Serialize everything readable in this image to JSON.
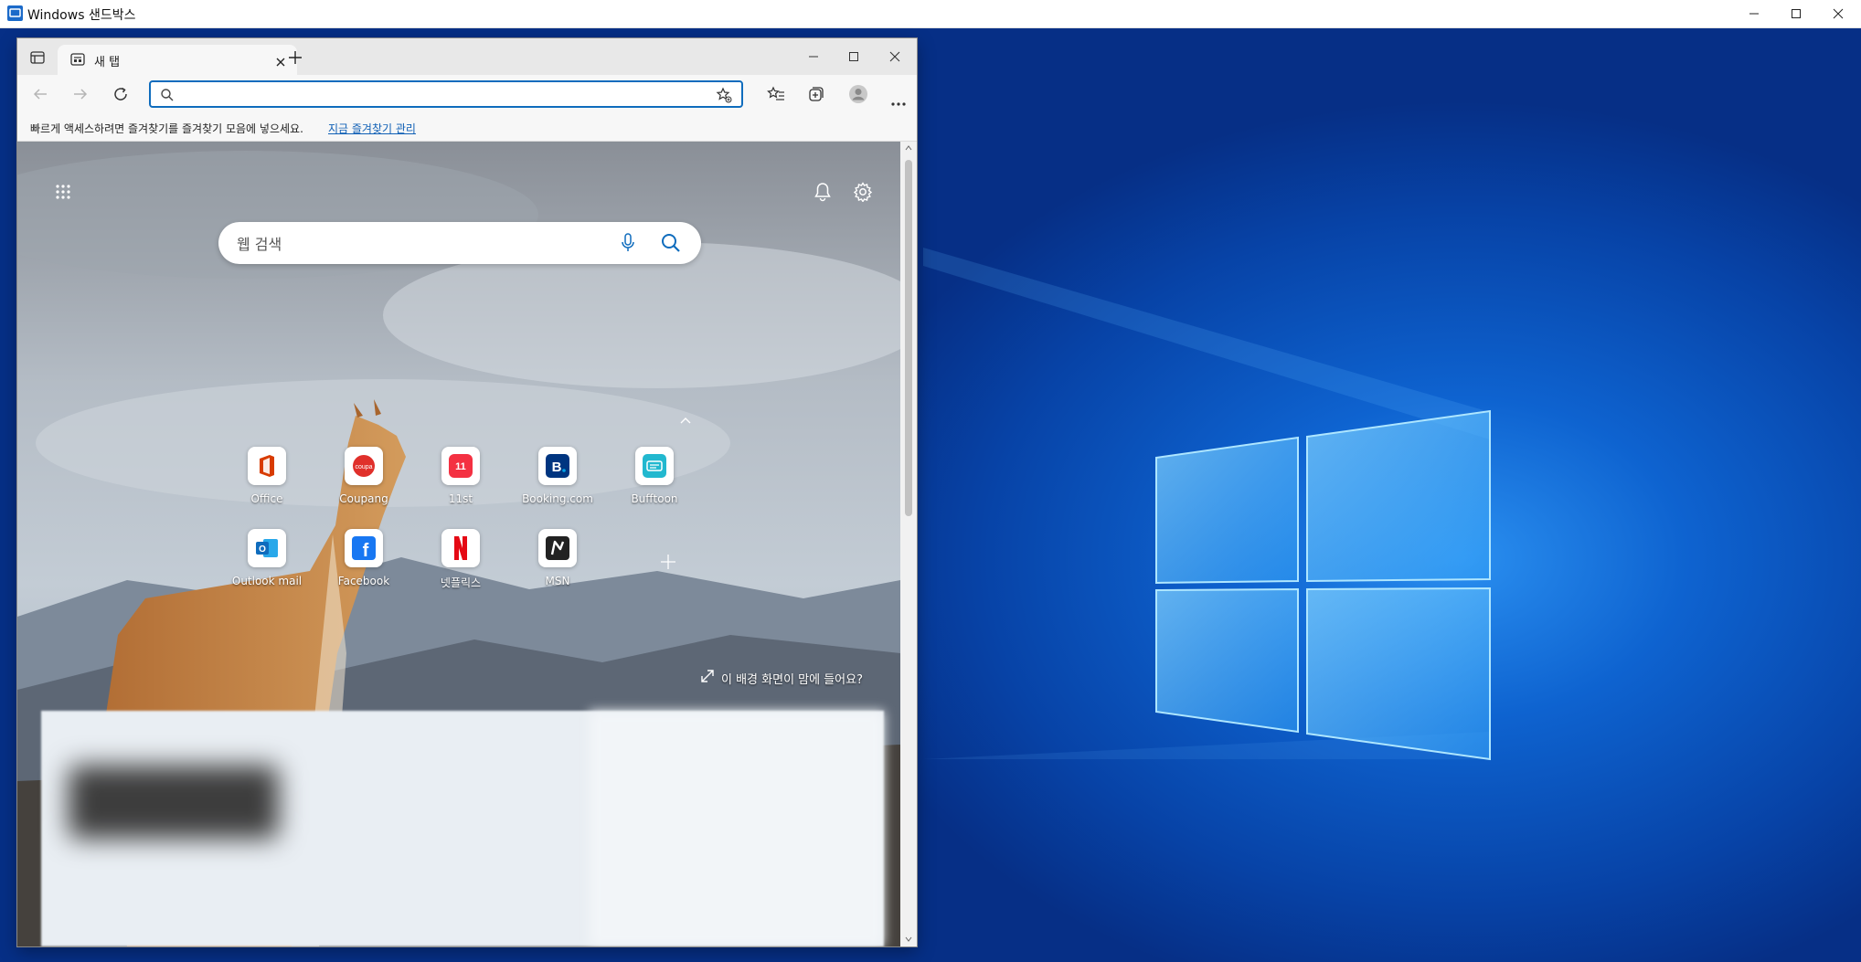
{
  "sandbox": {
    "title": "Windows 샌드박스"
  },
  "browser": {
    "tab": {
      "title": "새 탭"
    },
    "address": {
      "value": "",
      "placeholder": ""
    },
    "favorites_bar": {
      "message": "빠르게 액세스하려면 즐겨찾기를 즐겨찾기 모음에 넣으세요.",
      "link": "지금 즐겨찾기 관리"
    }
  },
  "ntp": {
    "search_placeholder": "웹 검색",
    "quick_links": [
      {
        "label": "Office",
        "icon": "office-icon",
        "color": "#d83b01"
      },
      {
        "label": "Coupang",
        "icon": "coupang-icon",
        "color": "#e0302b"
      },
      {
        "label": "11st",
        "icon": "11st-icon",
        "color": "#f43142"
      },
      {
        "label": "Booking.com",
        "icon": "booking-icon",
        "color": "#003580"
      },
      {
        "label": "Bufftoon",
        "icon": "bufftoon-icon",
        "color": "#22b8cf"
      },
      {
        "label": "Outlook mail",
        "icon": "outlook-icon",
        "color": "#0f6cbd"
      },
      {
        "label": "Facebook",
        "icon": "facebook-icon",
        "color": "#1877f2"
      },
      {
        "label": "넷플릭스",
        "icon": "netflix-icon",
        "color": "#e50914"
      },
      {
        "label": "MSN",
        "icon": "msn-icon",
        "color": "#222222"
      }
    ],
    "background_prompt": "이 배경 화면이 맘에 들어요?"
  }
}
